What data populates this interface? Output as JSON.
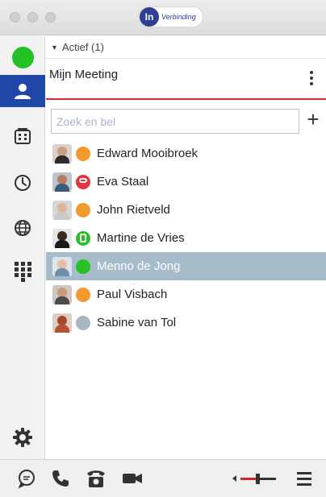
{
  "window": {
    "logo_badge": "In",
    "logo_text": "Verbinding",
    "brand_color": "#2e3f98"
  },
  "sidebar": {
    "items": [
      {
        "name": "status",
        "icon": "presence-available-icon"
      },
      {
        "name": "contacts",
        "icon": "person-icon",
        "active": true
      },
      {
        "name": "phonebook",
        "icon": "building-icon"
      },
      {
        "name": "history",
        "icon": "clock-icon"
      },
      {
        "name": "web",
        "icon": "globe-icon"
      },
      {
        "name": "dialpad",
        "icon": "dialpad-icon"
      },
      {
        "name": "settings",
        "icon": "gear-icon"
      }
    ],
    "active_color": "#1e47a8"
  },
  "section": {
    "label": "Actief (1)"
  },
  "meeting": {
    "title": "Mijn Meeting"
  },
  "search": {
    "placeholder": "Zoek en bel",
    "value": ""
  },
  "add_label": "+",
  "contacts": [
    {
      "name": "Edward Mooibroek",
      "status": "away",
      "color": "#f39a2e"
    },
    {
      "name": "Eva Staal",
      "status": "busy",
      "color": "#e5333f"
    },
    {
      "name": "John Rietveld",
      "status": "away",
      "color": "#f39a2e"
    },
    {
      "name": "Martine de Vries",
      "status": "in-call",
      "color": "#27c027"
    },
    {
      "name": "Menno de Jong",
      "status": "available",
      "color": "#27c027",
      "selected": true
    },
    {
      "name": "Paul Visbach",
      "status": "away",
      "color": "#f39a2e"
    },
    {
      "name": "Sabine van Tol",
      "status": "offline",
      "color": "#a7b7c4"
    }
  ],
  "toolbar": {
    "items": [
      "chat-icon",
      "phone-icon",
      "desk-phone-icon",
      "video-icon",
      "volume-slider",
      "menu-icon"
    ]
  }
}
